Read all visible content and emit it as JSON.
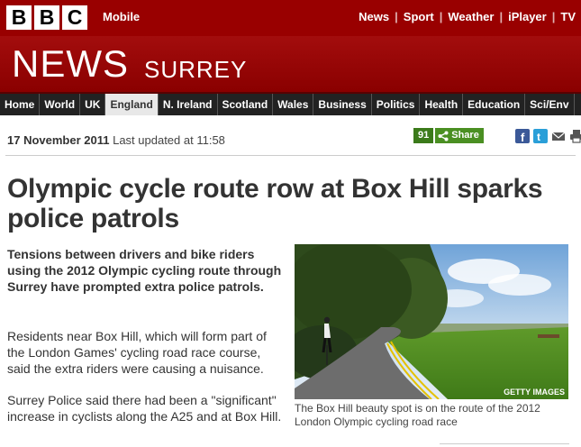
{
  "header": {
    "logo_letters": [
      "B",
      "B",
      "C"
    ],
    "mobile_label": "Mobile",
    "links": [
      "News",
      "Sport",
      "Weather",
      "iPlayer",
      "TV"
    ]
  },
  "banner": {
    "news": "NEWS",
    "region": "SURREY"
  },
  "nav": {
    "items": [
      "Home",
      "World",
      "UK",
      "England",
      "N. Ireland",
      "Scotland",
      "Wales",
      "Business",
      "Politics",
      "Health",
      "Education",
      "Sci/Env"
    ],
    "active": "England"
  },
  "article": {
    "date": "17 November 2011",
    "updated": "Last updated at 11:58",
    "share_count": "91",
    "share_label": "Share",
    "headline": "Olympic cycle route row at Box Hill sparks police patrols",
    "intro": "Tensions between drivers and bike riders using the 2012 Olympic cycling route through Surrey have prompted extra police patrols.",
    "para1": "Residents near Box Hill, which will form part of the London Games' cycling road race course, said the extra riders were causing a nuisance.",
    "para2": "Surrey Police said there had been a \"significant\" increase in cyclists along the A25 and at Box Hill.",
    "photo_credit": "GETTY IMAGES",
    "caption": "The Box Hill beauty spot is on the route of the 2012 London Olympic cycling road race"
  },
  "icons": [
    "share-icon",
    "facebook-icon",
    "twitter-icon",
    "email-icon",
    "print-icon"
  ],
  "colors": {
    "brand": "#990000",
    "nav": "#222222",
    "share": "#4a8f22"
  }
}
